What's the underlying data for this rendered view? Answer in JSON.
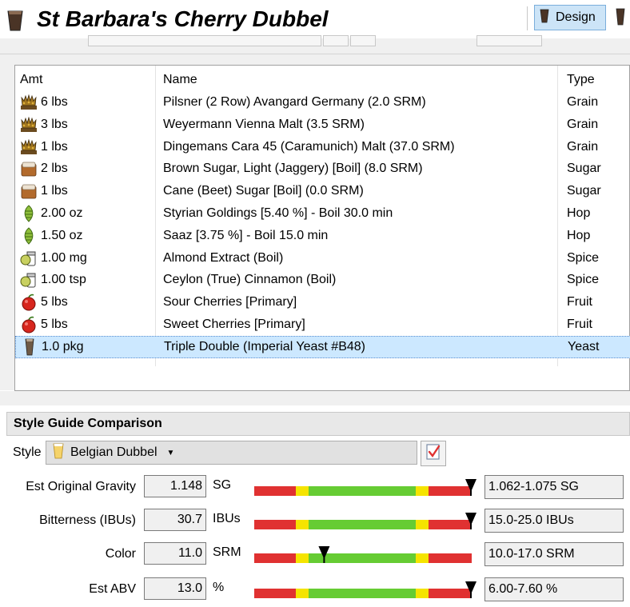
{
  "header": {
    "title": "St Barbara's Cherry Dubbel",
    "design_label": "Design"
  },
  "grid": {
    "columns": {
      "amt": "Amt",
      "name": "Name",
      "type": "Type"
    },
    "rows": [
      {
        "amt": "6 lbs",
        "name": "Pilsner (2 Row) Avangard Germany (2.0 SRM)",
        "type": "Grain",
        "icon": "grain-icon"
      },
      {
        "amt": "3 lbs",
        "name": "Weyermann Vienna Malt (3.5 SRM)",
        "type": "Grain",
        "icon": "grain-icon"
      },
      {
        "amt": "1 lbs",
        "name": "Dingemans Cara 45 (Caramunich) Malt (37.0 SRM)",
        "type": "Grain",
        "icon": "grain-icon"
      },
      {
        "amt": "2 lbs",
        "name": "Brown Sugar, Light (Jaggery) [Boil] (8.0 SRM)",
        "type": "Sugar",
        "icon": "sugar-icon"
      },
      {
        "amt": "1 lbs",
        "name": "Cane (Beet) Sugar [Boil] (0.0 SRM)",
        "type": "Sugar",
        "icon": "sugar-icon"
      },
      {
        "amt": "2.00 oz",
        "name": "Styrian Goldings [5.40 %] - Boil 30.0 min",
        "type": "Hop",
        "icon": "hop-icon"
      },
      {
        "amt": "1.50 oz",
        "name": "Saaz [3.75 %] - Boil 15.0 min",
        "type": "Hop",
        "icon": "hop-icon"
      },
      {
        "amt": "1.00 mg",
        "name": "Almond Extract (Boil)",
        "type": "Spice",
        "icon": "spice-icon"
      },
      {
        "amt": "1.00 tsp",
        "name": "Ceylon (True) Cinnamon (Boil)",
        "type": "Spice",
        "icon": "spice-icon"
      },
      {
        "amt": "5 lbs",
        "name": "Sour Cherries [Primary]",
        "type": "Fruit",
        "icon": "fruit-icon"
      },
      {
        "amt": "5 lbs",
        "name": "Sweet Cherries [Primary]",
        "type": "Fruit",
        "icon": "fruit-icon"
      },
      {
        "amt": "1.0 pkg",
        "name": "Triple Double (Imperial Yeast #B48)",
        "type": "Yeast",
        "icon": "yeast-icon",
        "selected": true
      }
    ]
  },
  "style_guide": {
    "section_title": "Style Guide Comparison",
    "style_label": "Style",
    "style_value": "Belgian Dubbel",
    "stats": [
      {
        "label": "Est Original Gravity",
        "value": "1.148",
        "unit": "SG",
        "range": "1.062-1.075 SG",
        "marker_fraction": 1.0
      },
      {
        "label": "Bitterness (IBUs)",
        "value": "30.7",
        "unit": "IBUs",
        "range": "15.0-25.0 IBUs",
        "marker_fraction": 1.0
      },
      {
        "label": "Color",
        "value": "11.0",
        "unit": "SRM",
        "range": "10.0-17.0 SRM",
        "marker_fraction": 0.32
      },
      {
        "label": "Est ABV",
        "value": "13.0",
        "unit": "%",
        "range": "6.00-7.60 %",
        "marker_fraction": 1.0
      }
    ]
  },
  "colors": {
    "bar_red": "#e03131",
    "bar_yellow": "#f5e400",
    "bar_green": "#66cc33",
    "selected_row": "#cce8ff"
  }
}
